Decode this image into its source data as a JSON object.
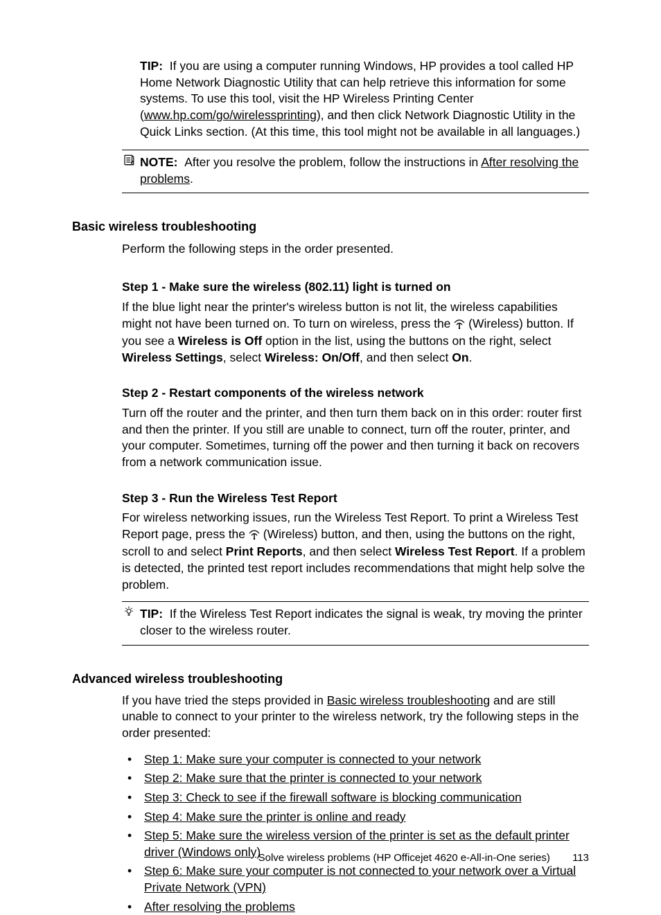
{
  "tip1": {
    "label": "TIP:",
    "text_before_link": "If you are using a computer running Windows, HP provides a tool called HP Home Network Diagnostic Utility that can help retrieve this information for some systems. To use this tool, visit the HP Wireless Printing Center (",
    "link": "www.hp.com/go/wirelessprinting",
    "text_after_link": "), and then click Network Diagnostic Utility in the Quick Links section. (At this time, this tool might not be available in all languages.)"
  },
  "note1": {
    "label": "NOTE:",
    "text_before_link": "After you resolve the problem, follow the instructions in ",
    "link": "After resolving the problems",
    "text_after_link": "."
  },
  "basic": {
    "heading": "Basic wireless troubleshooting",
    "intro": "Perform the following steps in the order presented.",
    "step1": {
      "title": "Step 1 - Make sure the wireless (802.11) light is turned on",
      "p1a": "If the blue light near the printer's wireless button is not lit, the wireless capabilities might not have been turned on. To turn on wireless, press the ",
      "p1b": " (Wireless) button. If you see a ",
      "bold1": "Wireless is Off",
      "p1c": " option in the list, using the buttons on the right, select ",
      "bold2": "Wireless Settings",
      "p1d": ", select ",
      "bold3": "Wireless: On/Off",
      "p1e": ", and then select ",
      "bold4": "On",
      "p1f": "."
    },
    "step2": {
      "title": "Step 2 - Restart components of the wireless network",
      "text": "Turn off the router and the printer, and then turn them back on in this order: router first and then the printer. If you still are unable to connect, turn off the router, printer, and your computer. Sometimes, turning off the power and then turning it back on recovers from a network communication issue."
    },
    "step3": {
      "title": "Step 3 - Run the Wireless Test Report",
      "p1a": "For wireless networking issues, run the Wireless Test Report. To print a Wireless Test Report page, press the ",
      "p1b": " (Wireless) button, and then, using the buttons on the right, scroll to and select ",
      "bold1": "Print Reports",
      "p1c": ", and then select ",
      "bold2": "Wireless Test Report",
      "p1d": ". If a problem is detected, the printed test report includes recommendations that might help solve the problem."
    },
    "tip2": {
      "label": "TIP:",
      "text": "If the Wireless Test Report indicates the signal is weak, try moving the printer closer to the wireless router."
    }
  },
  "advanced": {
    "heading": "Advanced wireless troubleshooting",
    "intro_a": "If you have tried the steps provided in ",
    "intro_link": "Basic wireless troubleshooting",
    "intro_b": " and are still unable to connect to your printer to the wireless network, try the following steps in the order presented:",
    "steps": [
      "Step 1: Make sure your computer is connected to your network",
      "Step 2: Make sure that the printer is connected to your network",
      "Step 3: Check to see if the firewall software is blocking communication",
      "Step 4: Make sure the printer is online and ready",
      "Step 5: Make sure the wireless version of the printer is set as the default printer driver (Windows only)",
      "Step 6: Make sure your computer is not connected to your network over a Virtual Private Network (VPN)",
      "After resolving the problems"
    ]
  },
  "footer": {
    "text": "Solve wireless problems (HP Officejet 4620 e-All-in-One series)",
    "page": "113"
  }
}
